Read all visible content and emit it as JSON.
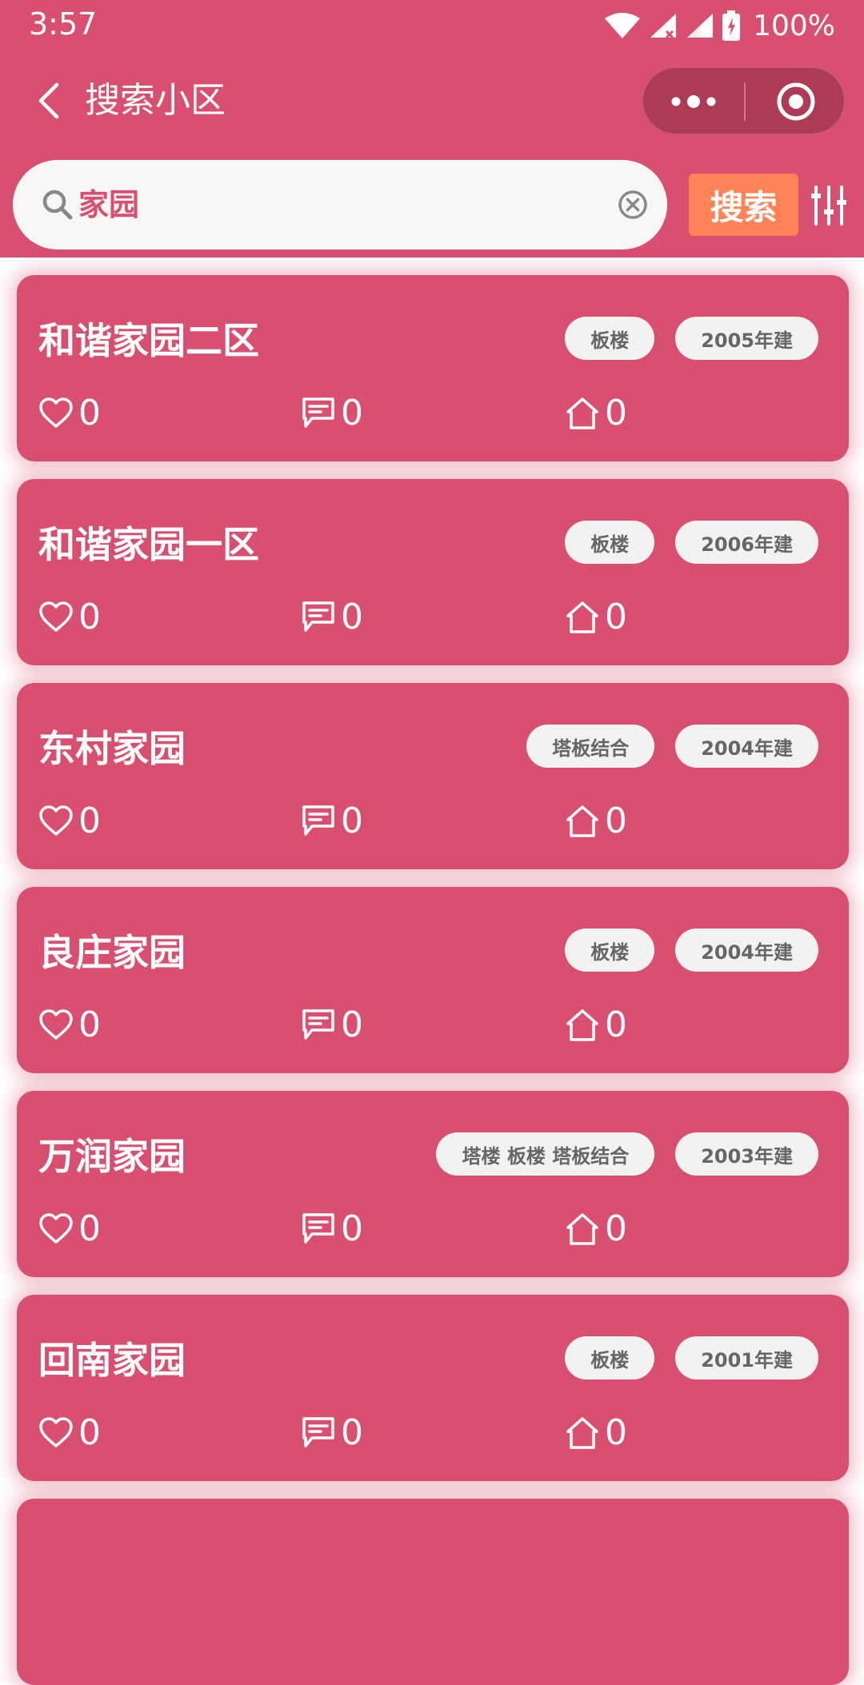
{
  "status_bar": {
    "time": "3:57",
    "battery": "100%"
  },
  "nav": {
    "title": "搜索小区"
  },
  "search": {
    "value": "家园",
    "button_label": "搜索"
  },
  "colors": {
    "theme": "#D94F6F",
    "search_button": "#FF8357",
    "tag_bg": "#F2F2F2",
    "tag_text": "#666666"
  },
  "icons": {
    "like": "heart-outline",
    "comment": "speech-bubble",
    "house": "house-outline"
  },
  "communities": [
    {
      "name": "和谐家园二区",
      "tags": [
        "板楼",
        "2005年建"
      ],
      "likes": "0",
      "comments": "0",
      "houses": "0"
    },
    {
      "name": "和谐家园一区",
      "tags": [
        "板楼",
        "2006年建"
      ],
      "likes": "0",
      "comments": "0",
      "houses": "0"
    },
    {
      "name": "东村家园",
      "tags": [
        "塔板结合",
        "2004年建"
      ],
      "likes": "0",
      "comments": "0",
      "houses": "0"
    },
    {
      "name": "良庄家园",
      "tags": [
        "板楼",
        "2004年建"
      ],
      "likes": "0",
      "comments": "0",
      "houses": "0"
    },
    {
      "name": "万润家园",
      "tags": [
        "塔楼 板楼 塔板结合",
        "2003年建"
      ],
      "likes": "0",
      "comments": "0",
      "houses": "0"
    },
    {
      "name": "回南家园",
      "tags": [
        "板楼",
        "2001年建"
      ],
      "likes": "0",
      "comments": "0",
      "houses": "0"
    }
  ]
}
